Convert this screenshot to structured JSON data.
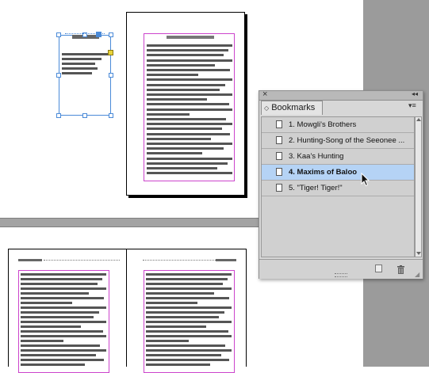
{
  "bookmarks_panel": {
    "title": "Bookmarks",
    "collapse_glyph": "◂◂",
    "close_glyph": "×",
    "menu_glyph": "▾≡",
    "items": [
      {
        "label": "1.  Mowgli's Brothers",
        "selected": false
      },
      {
        "label": "2.  Hunting-Song of the Seeonee ...",
        "selected": false
      },
      {
        "label": "3.  Kaa's Hunting",
        "selected": false
      },
      {
        "label": "4.  Maxims of Baloo",
        "selected": true
      },
      {
        "label": "5.  \"Tiger! Tiger!\"",
        "selected": false
      }
    ],
    "icons": {
      "new": "new-bookmark-icon",
      "delete": "trash-icon"
    }
  },
  "colors": {
    "selection_blue": "#4a8ad8",
    "margin_guide": "#cc44cc",
    "selected_row": "#b5d3f5",
    "text_bar": "#555555"
  }
}
